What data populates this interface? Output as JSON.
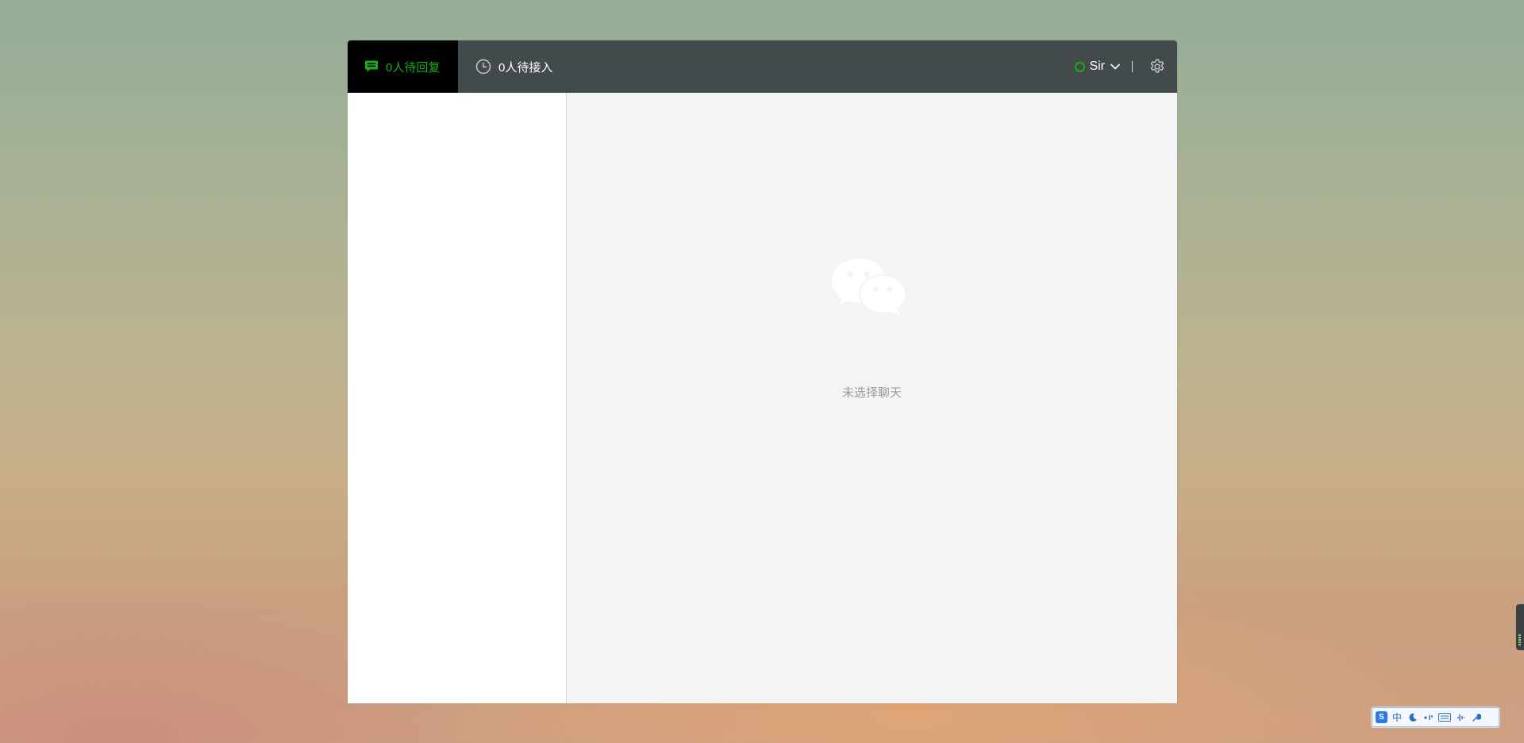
{
  "header": {
    "tab_reply_label": "0人待回复",
    "tab_waiting_label": "0人待接入",
    "user_name": "Sir",
    "status_color": "#1aad19",
    "icons": [
      "chat-bubble-icon",
      "clock-icon",
      "chevron-down-icon",
      "gear-icon"
    ]
  },
  "main": {
    "empty_label": "未选择聊天",
    "empty_icon": "wechat-logo-icon"
  },
  "ime_toolbar": {
    "lang_label": "中",
    "items": [
      "logo",
      "中",
      "moon-icon",
      "punctuation-icon",
      "keyboard-icon",
      "voice-icon",
      "wrench-icon"
    ]
  },
  "colors": {
    "accent": "#1aad19",
    "topbar": "#434a4c",
    "active_tab": "#000000",
    "pane_bg": "#f4f4f4"
  }
}
